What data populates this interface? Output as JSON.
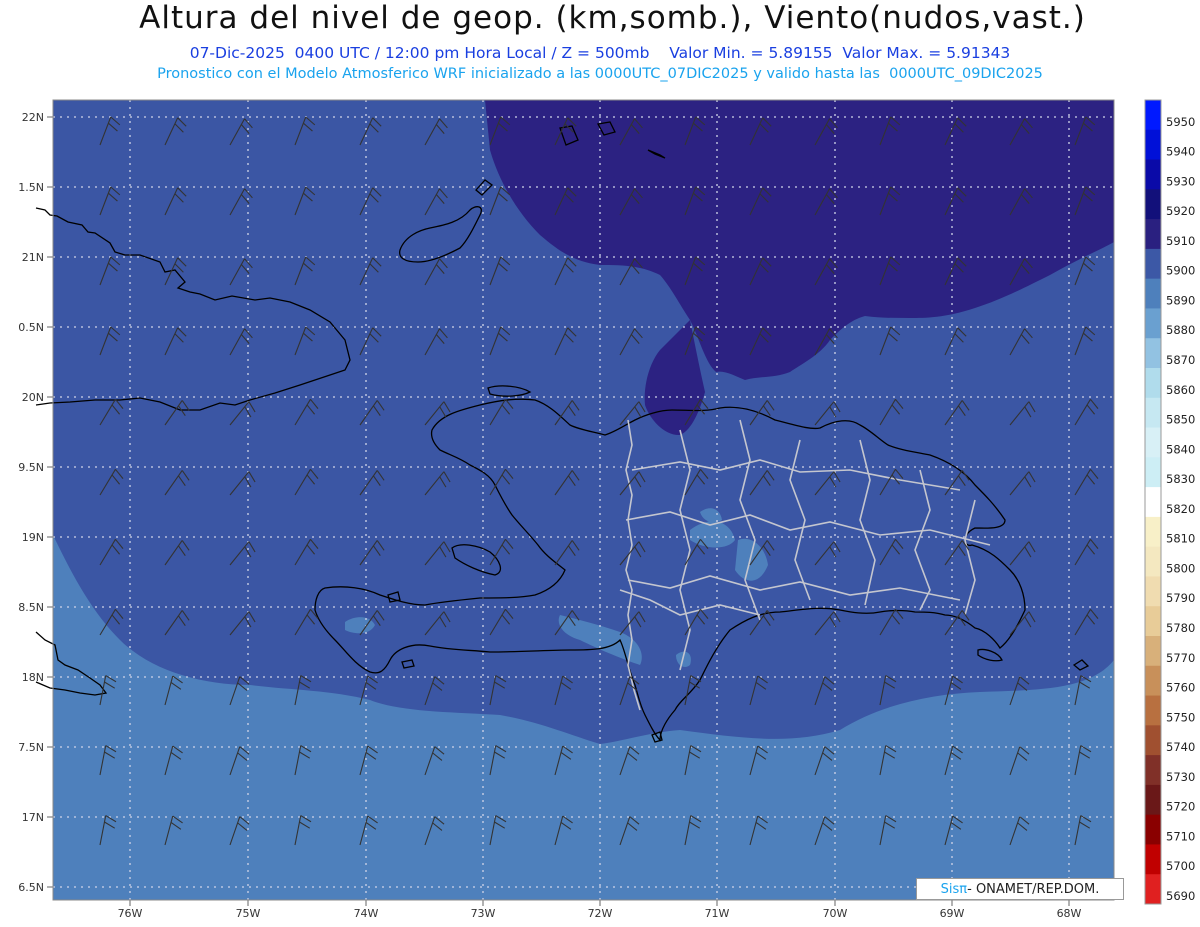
{
  "header": {
    "title": "Altura del nivel de geop. (km,somb.), Viento(nudos,vast.)",
    "subtitle_1": "07-Dic-2025  0400 UTC / 12:00 pm Hora Local / Z = 500mb    Valor Min. = 5.89155  Valor Max. = 5.91343",
    "subtitle_2": "Pronostico con el Modelo Atmosferico WRF inicializado a las 0000UTC_07DIC2025 y valido hasta las  0000UTC_09DIC2025"
  },
  "latitude_labels": [
    "22N",
    "1.5N",
    "21N",
    "0.5N",
    "20N",
    "9.5N",
    "19N",
    "8.5N",
    "18N",
    "7.5N",
    "17N",
    "6.5N"
  ],
  "longitude_labels": [
    "76W",
    "75W",
    "74W",
    "73W",
    "72W",
    "71W",
    "70W",
    "69W",
    "68W"
  ],
  "colorbar": {
    "levels": [
      "5950",
      "5940",
      "5930",
      "5920",
      "5910",
      "5900",
      "5890",
      "5880",
      "5870",
      "5860",
      "5850",
      "5840",
      "5830",
      "5820",
      "5810",
      "5800",
      "5790",
      "5780",
      "5770",
      "5760",
      "5750",
      "5740",
      "5730",
      "5720",
      "5710",
      "5700",
      "5690"
    ],
    "colors": [
      "#0019ff",
      "#0010d8",
      "#0a0aa8",
      "#12107a",
      "#2a2080",
      "#3c58a6",
      "#4e80bc",
      "#6aa0d0",
      "#92c2e2",
      "#b0dcec",
      "#c6e8f2",
      "#d8f0f6",
      "#cdeef5",
      "#ffffff",
      "#f8f0c8",
      "#f4e8c0",
      "#f0dcb0",
      "#e8cc98",
      "#d8b07a",
      "#c8905a",
      "#b87040",
      "#a05030",
      "#803028",
      "#6a1818",
      "#8a0000",
      "#c00000",
      "#e02020"
    ]
  },
  "map_colors": {
    "level_5910": "#2c2282",
    "level_5900": "#3b56a4",
    "level_5890": "#4e80bc"
  },
  "credit": {
    "brand": "Sisπ",
    "text": " - ONAMET/REP.DOM."
  }
}
